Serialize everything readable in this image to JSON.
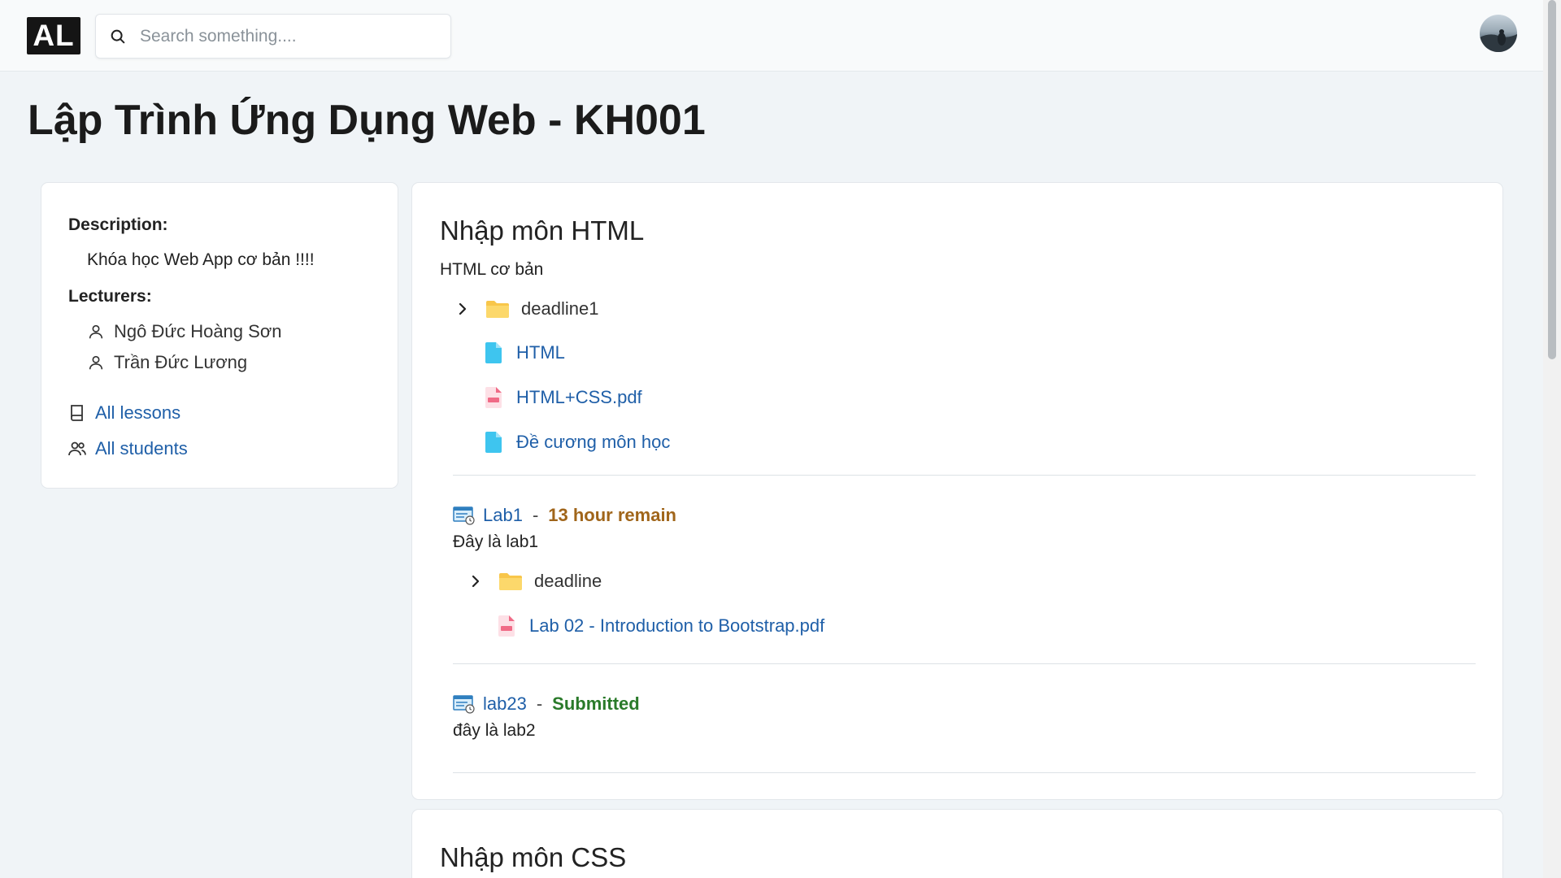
{
  "header": {
    "logo": "AL",
    "search_placeholder": "Search something...."
  },
  "course": {
    "title": "Lập Trình Ứng Dụng Web - KH001"
  },
  "info": {
    "description_label": "Description:",
    "description": "Khóa học Web App cơ bản !!!!",
    "lecturers_label": "Lecturers:",
    "lecturers": [
      "Ngô Đức Hoàng Sơn",
      "Trần Đức Lương"
    ],
    "all_lessons": "All lessons",
    "all_students": "All students"
  },
  "sections": [
    {
      "title": "Nhập môn HTML",
      "subtitle": "HTML cơ bản",
      "folder": "deadline1",
      "files": [
        {
          "name": "HTML",
          "type": "doc"
        },
        {
          "name": "HTML+CSS.pdf",
          "type": "pdf"
        },
        {
          "name": "Đề cương môn học",
          "type": "doc"
        }
      ],
      "labs": [
        {
          "name": "Lab1",
          "separator": "-",
          "status": "13 hour remain",
          "description": "Đây là lab1",
          "folder": "deadline",
          "file": "Lab 02 - Introduction to Bootstrap.pdf"
        },
        {
          "name": "lab23",
          "separator": "-",
          "status": "Submitted",
          "description": "đây là lab2"
        }
      ]
    },
    {
      "title": "Nhập môn CSS"
    }
  ],
  "colors": {
    "link": "#1f5fa8",
    "remain": "#a0651a",
    "submitted": "#2a7a2a",
    "doc_icon": "#3ec5ef",
    "pdf_icon": "#f06a86",
    "folder_icon": "#f8c64a"
  }
}
